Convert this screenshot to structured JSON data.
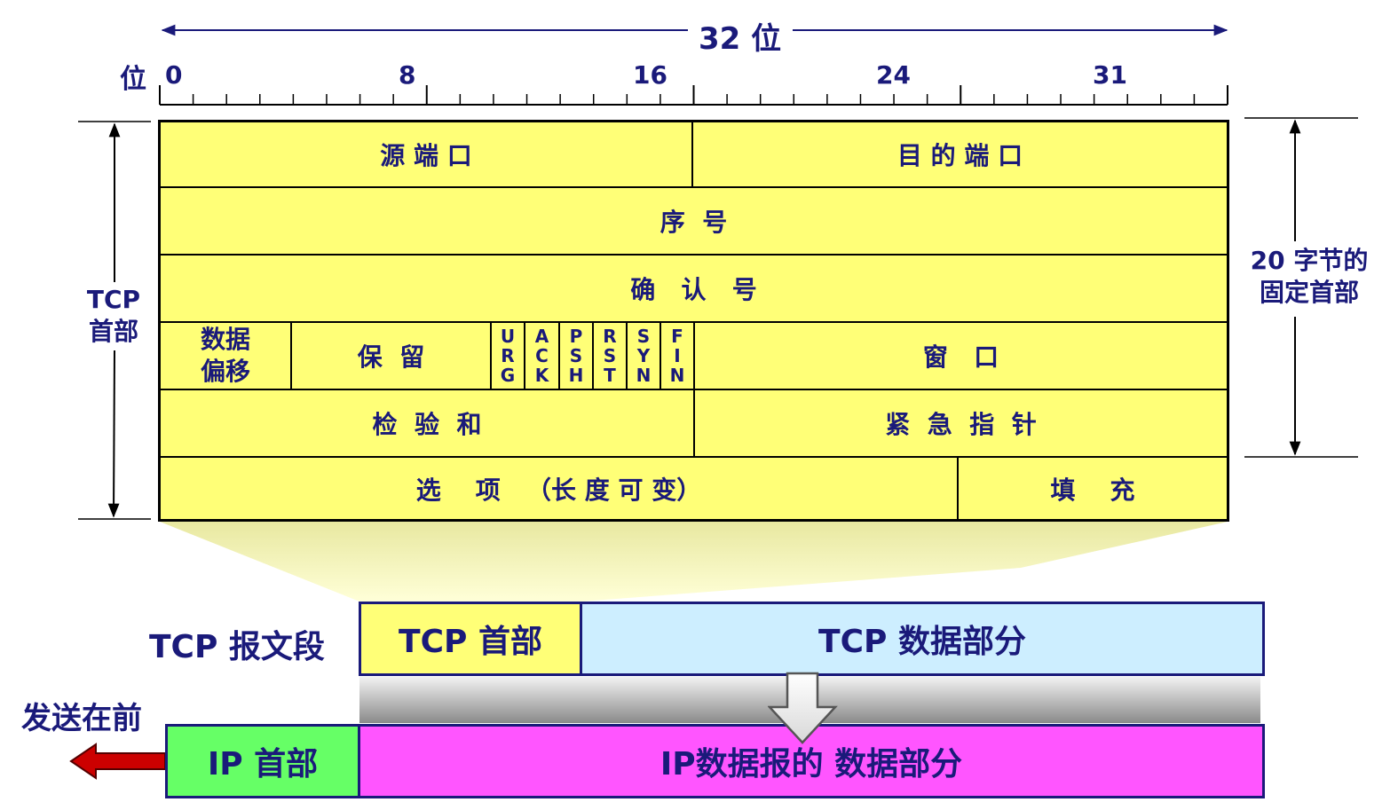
{
  "bit_scale": {
    "span_label": "32 位",
    "unit_label": "位",
    "ticks": [
      "0",
      "8",
      "16",
      "24",
      "31"
    ]
  },
  "header_fields": {
    "source_port": "源 端 口",
    "dest_port": "目 的 端 口",
    "sequence_number": "序  号",
    "ack_number": "确   认   号",
    "data_offset": "数据\n偏移",
    "reserved": "保  留",
    "flags": [
      "U\nR\nG",
      "A\nC\nK",
      "P\nS\nH",
      "R\nS\nT",
      "S\nY\nN",
      "F\nI\nN"
    ],
    "window": "窗   口",
    "checksum": "检  验  和",
    "urgent_pointer": "紧  急  指  针",
    "options": "选    项   （长 度 可 变）",
    "padding": "填    充"
  },
  "side_labels": {
    "tcp_header": "TCP\n首部",
    "fixed_header": "20 字节的\n固定首部"
  },
  "segment": {
    "label": "TCP 报文段",
    "header": "TCP 首部",
    "data": "TCP 数据部分"
  },
  "ip_datagram": {
    "send_first": "发送在前",
    "header": "IP 首部",
    "data": "IP数据报的 数据部分"
  },
  "colors": {
    "field_fill": "#ffff77",
    "border": "#000000",
    "text": "#1a1a7a",
    "tcp_data_fill": "#cdeeff",
    "ip_header_fill": "#66ff66",
    "ip_data_fill": "#ff55ff",
    "arrow_red": "#cc0000"
  }
}
